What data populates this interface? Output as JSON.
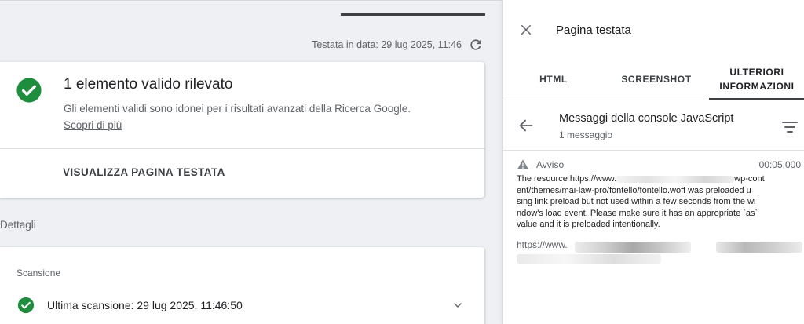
{
  "left": {
    "tested_on": "Testata in data: 29 lug 2025, 11:46",
    "result": {
      "title": "1 elemento valido rilevato",
      "description": "Gli elementi validi sono idonei per i risultati avanzati della Ricerca Google.",
      "learn_more": "Scopri di più",
      "view_button": "VISUALIZZA PAGINA TESTATA"
    },
    "details_label": "Dettagli",
    "scan": {
      "section_label": "Scansione",
      "last_scan": "Ultima scansione: 29 lug 2025, 11:46:50"
    }
  },
  "panel": {
    "title": "Pagina testata",
    "tabs": [
      {
        "label": "HTML"
      },
      {
        "label": "SCREENSHOT"
      },
      {
        "label_line1": "ULTERIORI",
        "label_line2": "INFORMAZIONI"
      }
    ],
    "console": {
      "title": "Messaggi della console JavaScript",
      "count": "1 messaggio"
    },
    "message": {
      "level": "Avviso",
      "time": "00:05.000",
      "line1_start": "The resource https://www.",
      "line1_end": "wp-cont",
      "line2": "ent/themes/mai-law-pro/fontello/fontello.woff was preloaded u",
      "line3": "sing link preload but not used within a few seconds from the wi",
      "line4": "ndow's load event. Please make sure it has an appropriate `as`",
      "line5": "value and it is preloaded intentionally.",
      "url_start": "https://www."
    }
  },
  "colors": {
    "success_green": "#1e8e3e",
    "page_bg": "#eef0f3"
  },
  "icons": [
    "refresh-icon",
    "check-circle-icon",
    "chevron-down-icon",
    "close-icon",
    "arrow-back-icon",
    "filter-icon",
    "warning-icon"
  ]
}
